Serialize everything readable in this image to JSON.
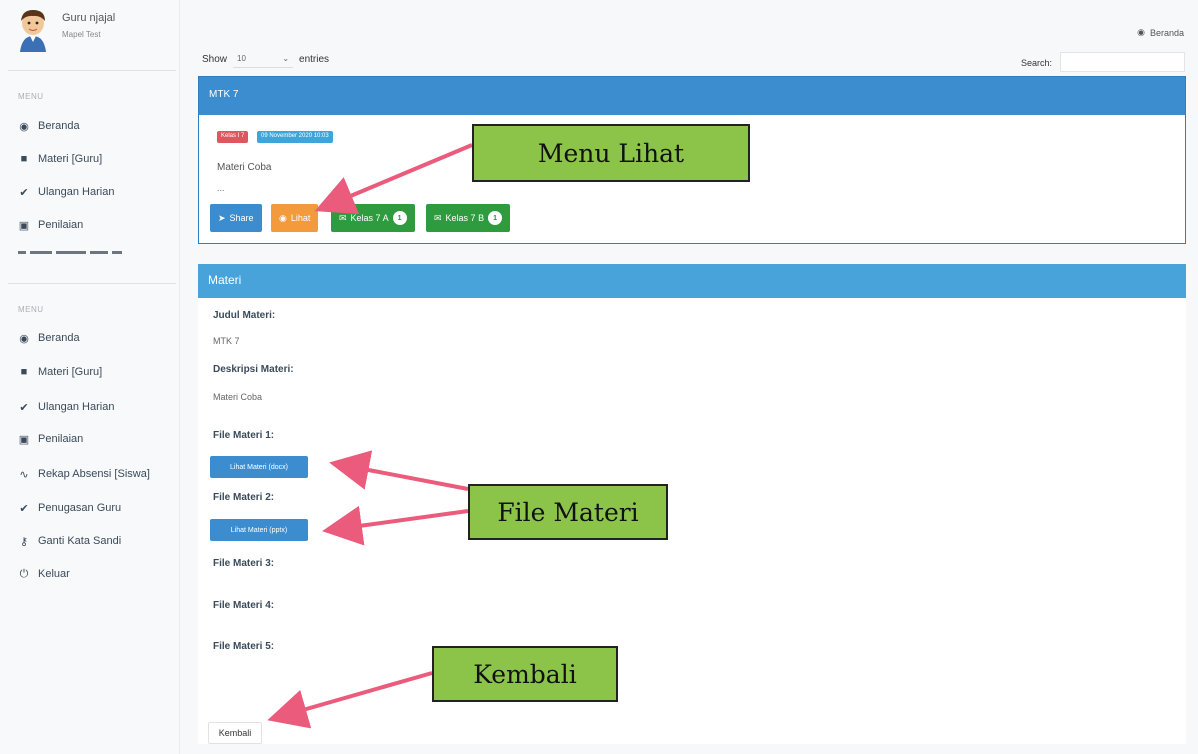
{
  "sidebar": {
    "user_name": "Guru njajal",
    "user_sub": "Mapel Test",
    "menu_title_1": "MENU",
    "menu_title_2": "MENU",
    "menu1": [
      {
        "label": "Beranda",
        "icon": "dashboard-icon"
      },
      {
        "label": "Materi [Guru]",
        "icon": "folder-icon"
      },
      {
        "label": "Ulangan Harian",
        "icon": "check-icon"
      },
      {
        "label": "Penilaian",
        "icon": "grade-icon"
      }
    ],
    "menu2": [
      {
        "label": "Beranda",
        "icon": "dashboard-icon"
      },
      {
        "label": "Materi [Guru]",
        "icon": "folder-icon"
      },
      {
        "label": "Ulangan Harian",
        "icon": "check-icon"
      },
      {
        "label": "Penilaian",
        "icon": "grade-icon"
      },
      {
        "label": "Rekap Absensi [Siswa]",
        "icon": "chart-icon"
      },
      {
        "label": "Penugasan Guru",
        "icon": "check-icon"
      },
      {
        "label": "Ganti Kata Sandi",
        "icon": "key-icon"
      },
      {
        "label": "Keluar",
        "icon": "power-icon"
      }
    ]
  },
  "header": {
    "breadcrumb": "Beranda"
  },
  "table_controls": {
    "show_label": "Show",
    "entries_value": "10",
    "entries_label": "entries",
    "search_label": "Search:"
  },
  "card": {
    "title": "MTK 7",
    "badge_class": "Kelas I 7",
    "badge_date": "09 November 2020 10:03",
    "description": "Materi Coba",
    "ellipsis": "...",
    "buttons": {
      "share": "Share",
      "lihat": "Lihat",
      "kelas_a": "Kelas 7 A",
      "kelas_a_count": "1",
      "kelas_b": "Kelas 7 B",
      "kelas_b_count": "1"
    }
  },
  "materi": {
    "header": "Materi",
    "judul_label": "Judul Materi:",
    "judul_value": "MTK 7",
    "deskripsi_label": "Deskripsi Materi:",
    "deskripsi_value": "Materi Coba",
    "files": [
      {
        "label": "File Materi 1:",
        "button": "Lihat Materi (docx)"
      },
      {
        "label": "File Materi 2:",
        "button": "Lihat Materi (pptx)"
      },
      {
        "label": "File Materi 3:"
      },
      {
        "label": "File Materi 4:"
      },
      {
        "label": "File Materi 5:"
      }
    ],
    "back_button": "Kembali"
  },
  "annotations": {
    "menu_lihat": "Menu Lihat",
    "file_materi": "File Materi",
    "kembali": "Kembali"
  },
  "colors": {
    "primary": "#3c8dcf",
    "success": "#2e9b3f",
    "warning": "#f39a3c",
    "danger": "#e0565e",
    "callout": "#8cc44a",
    "arrow": "#ea5b7c"
  }
}
